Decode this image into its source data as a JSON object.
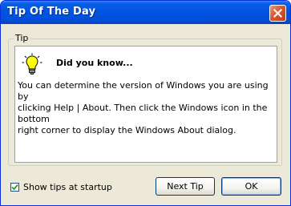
{
  "window": {
    "title": "Tip Of The Day",
    "close_icon": "close-icon"
  },
  "tip_group": {
    "label": "Tip"
  },
  "tip": {
    "icon": "lightbulb-icon",
    "heading": "Did you know...",
    "body": "You can determine the version of Windows you are using by\nclicking Help | About. Then click the Windows icon in the bottom\nright corner to display the Windows About dialog."
  },
  "startup_option": {
    "label": "Show tips at startup",
    "checked": true
  },
  "buttons": {
    "next_label": "Next Tip",
    "ok_label": "OK"
  },
  "colors": {
    "titlebar": "#0054e3",
    "dialog_bg": "#ece9d8",
    "close_button": "#d9572f",
    "bulb": "#ffff00"
  }
}
